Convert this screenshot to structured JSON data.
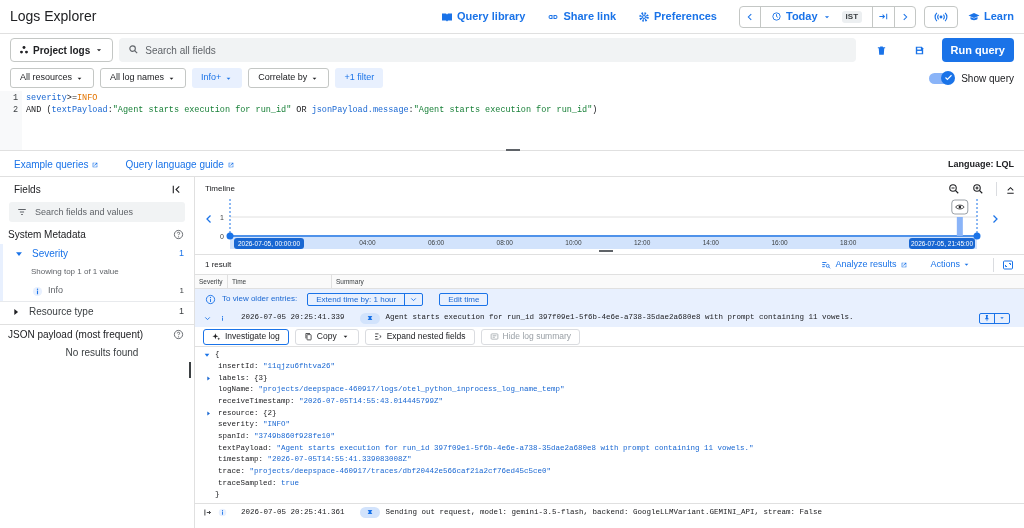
{
  "header": {
    "title": "Logs Explorer",
    "links": [
      "Query library",
      "Share link",
      "Preferences"
    ],
    "time_range": "Today",
    "timezone": "IST",
    "learn": "Learn"
  },
  "toolbar": {
    "scope": "Project logs",
    "search": {
      "placeholder": "Search all fields"
    },
    "run_button": "Run query"
  },
  "filters": [
    {
      "label": "All resources",
      "active": false,
      "dropdown": true
    },
    {
      "label": "All log names",
      "active": false,
      "dropdown": true
    },
    {
      "label": "Info+",
      "active": true,
      "dropdown": true
    },
    {
      "label": "Correlate by",
      "active": false,
      "dropdown": true
    },
    {
      "label": "+1 filter",
      "active": true,
      "dropdown": false
    }
  ],
  "show_query": {
    "label": "Show query",
    "on": true
  },
  "query_lines": [
    {
      "number": "1",
      "tokens": [
        {
          "kind": "field",
          "text": "severity"
        },
        {
          "kind": "plain",
          "text": ">="
        },
        {
          "kind": "keyword",
          "text": "INFO"
        }
      ]
    },
    {
      "number": "2",
      "tokens": [
        {
          "kind": "plain",
          "text": "AND ("
        },
        {
          "kind": "field",
          "text": "textPayload"
        },
        {
          "kind": "plain",
          "text": ":"
        },
        {
          "kind": "string",
          "text": "\"Agent starts execution for run_id\""
        },
        {
          "kind": "plain",
          "text": " OR "
        },
        {
          "kind": "field",
          "text": "jsonPayload.message"
        },
        {
          "kind": "plain",
          "text": ":"
        },
        {
          "kind": "string",
          "text": "\"Agent starts execution for run_id\""
        },
        {
          "kind": "plain",
          "text": ")"
        }
      ]
    }
  ],
  "editor_links": [
    "Example queries",
    "Query language guide"
  ],
  "language": "Language: LQL",
  "fields_panel": {
    "title": "Fields",
    "search": {
      "placeholder": "Search fields and values"
    },
    "sections": [
      {
        "title": "System Metadata",
        "fields": [
          {
            "name": "Severity",
            "count": "1",
            "expanded": true,
            "note": "Showing top 1 of 1 value",
            "values": [
              {
                "label": "Info",
                "count": "1"
              }
            ]
          },
          {
            "name": "Resource type",
            "count": "1",
            "expanded": false
          }
        ]
      },
      {
        "title": "JSON payload (most frequent)",
        "empty_message": "No results found"
      }
    ]
  },
  "timeline": {
    "title": "Timeline",
    "start_label": "2026-07-05, 00:00:00",
    "end_label": "2026-07-05, 21:45:00",
    "chart_data": {
      "type": "bar",
      "x": [
        21.25
      ],
      "values": [
        1
      ],
      "xlim": [
        0,
        21.75
      ],
      "ylim": [
        0,
        1
      ],
      "yticks": [
        0,
        1
      ],
      "xticks": [
        {
          "value": 4,
          "label": "04:00"
        },
        {
          "value": 6,
          "label": "06:00"
        },
        {
          "value": 8,
          "label": "08:00"
        },
        {
          "value": 10,
          "label": "10:00"
        },
        {
          "value": 12,
          "label": "12:00"
        },
        {
          "value": 14,
          "label": "14:00"
        },
        {
          "value": 16,
          "label": "16:00"
        },
        {
          "value": 18,
          "label": "18:00"
        }
      ]
    }
  },
  "results": {
    "count": "1 result",
    "analyze": "Analyze results",
    "actions": "Actions",
    "columns": [
      "Severity",
      "Time",
      "Summary"
    ],
    "notice": {
      "text": "To view older entries:",
      "extend": "Extend time by: 1 hour",
      "edit": "Edit time"
    },
    "entries": [
      {
        "expanded": true,
        "time": "2026-07-05 20:25:41.339",
        "summary": "Agent starts execution for run_id 397f09e1-5f6b-4e6e-a738-35dae2a680e8 with prompt containing 11 vowels.",
        "actions": [
          {
            "label": "Investigate log",
            "disabled": false,
            "dropdown": false
          },
          {
            "label": "Copy",
            "disabled": false,
            "dropdown": true
          },
          {
            "label": "Expand nested fields",
            "disabled": false,
            "dropdown": false
          },
          {
            "label": "Hide log summary",
            "disabled": true,
            "dropdown": false
          }
        ],
        "open": "{",
        "close": "}",
        "payload": [
          {
            "key": "insertId:",
            "value": "\"11qjzu6fhtva26\"",
            "kind": "string"
          },
          {
            "key": "labels:",
            "value": "{3}",
            "kind": "object"
          },
          {
            "key": "logName:",
            "value": "\"projects/deepspace-460917/logs/otel_python_inprocess_log_name_temp\"",
            "kind": "string"
          },
          {
            "key": "receiveTimestamp:",
            "value": "\"2026-07-05T14:55:43.014445799Z\"",
            "kind": "string"
          },
          {
            "key": "resource:",
            "value": "{2}",
            "kind": "object"
          },
          {
            "key": "severity:",
            "value": "\"INFO\"",
            "kind": "string"
          },
          {
            "key": "spanId:",
            "value": "\"3749b860f928fe10\"",
            "kind": "string"
          },
          {
            "key": "textPayload:",
            "value": "\"Agent starts execution for run_id 397f09e1-5f6b-4e6e-a738-35dae2a680e8 with prompt containing 11 vowels.\"",
            "kind": "string"
          },
          {
            "key": "timestamp:",
            "value": "\"2026-07-05T14:55:41.339083008Z\"",
            "kind": "string"
          },
          {
            "key": "trace:",
            "value": "\"projects/deepspace-460917/traces/dbf20442e566caf21a2cf76ed45c5ce0\"",
            "kind": "string"
          },
          {
            "key": "traceSampled:",
            "value": "true",
            "kind": "bool"
          }
        ]
      },
      {
        "expanded": false,
        "time": "2026-07-05 20:25:41.361",
        "summary": "Sending out request, model: gemini-3.5-flash, backend: GoogleLLMVariant.GEMINI_API, stream: False"
      }
    ]
  }
}
